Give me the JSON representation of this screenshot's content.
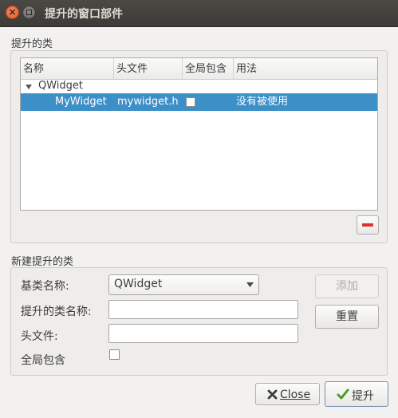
{
  "window": {
    "title": "提升的窗口部件"
  },
  "promoted_group": {
    "label": "提升的类",
    "columns": [
      "名称",
      "头文件",
      "全局包含",
      "用法"
    ],
    "tree": {
      "parent": "QWidget",
      "rows": [
        {
          "name": "MyWidget",
          "header": "mywidget.h",
          "global_include": false,
          "usage": "没有被使用",
          "selected": true
        }
      ]
    },
    "remove_icon": "minus-icon"
  },
  "new_group": {
    "label": "新建提升的类",
    "base_class_label": "基类名称:",
    "base_class_value": "QWidget",
    "promoted_class_label": "提升的类名称:",
    "promoted_class_value": "",
    "header_label": "头文件:",
    "header_value": "",
    "global_include_label": "全局包含",
    "add_button": "添加",
    "reset_button": "重置"
  },
  "footer": {
    "close_button": "Close",
    "promote_button": "提升"
  },
  "colors": {
    "selection": "#3d8fc8",
    "titlebar": "#3c3b37"
  }
}
